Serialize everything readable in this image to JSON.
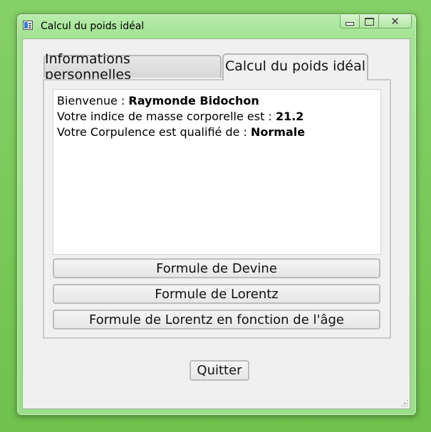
{
  "window": {
    "title": "Calcul du poids idéal",
    "icon": "app-form-icon",
    "caption_buttons": [
      "minimize",
      "maximize",
      "close"
    ]
  },
  "tabs": [
    {
      "label": "Informations personnelles",
      "active": false
    },
    {
      "label": "Calcul du poids idéal",
      "active": true
    }
  ],
  "info": {
    "welcome_prefix": "Bienvenue : ",
    "name": "Raymonde Bidochon",
    "bmi_prefix": "Votre indice de masse corporelle est : ",
    "bmi_value": "21.2",
    "corpulence_prefix": "Votre Corpulence est qualifié de : ",
    "corpulence_value": "Normale"
  },
  "buttons": {
    "devine": "Formule de Devine",
    "lorentz": "Formule de Lorentz",
    "lorentz_age": "Formule de Lorentz en fonction de l'âge",
    "quit": "Quitter"
  },
  "colors": {
    "desktop": "#7ac95a",
    "frame": "#a3e393",
    "client": "#f0f0f0"
  }
}
